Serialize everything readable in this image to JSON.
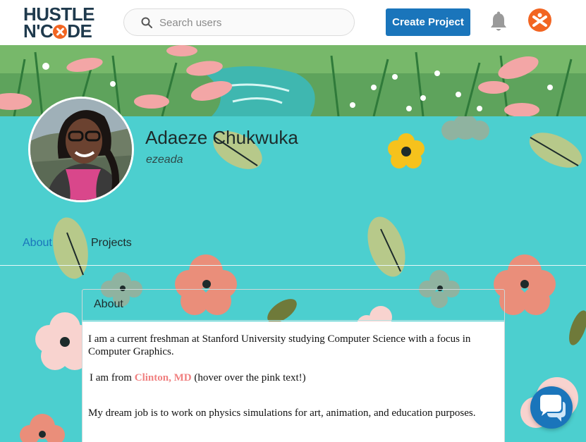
{
  "header": {
    "logo_line1": "HUSTLE",
    "logo_line2_prefix": "N'C",
    "logo_line2_suffix": "DE",
    "search_placeholder": "Search users",
    "create_label": "Create Project"
  },
  "profile": {
    "name": "Adaeze Chukwuka",
    "username": "ezeada"
  },
  "tabs": {
    "about": "About",
    "projects": "Projects"
  },
  "about_card": {
    "title": "About",
    "p1": "I am a current freshman at Stanford University studying Computer Science with a focus in Computer Graphics.",
    "p2_prefix": "I am from ",
    "p2_link": "Clinton, MD",
    "p2_suffix": " (hover over the pink text!)",
    "p3": "My dream job is to work on physics simulations for art, animation, and education purposes."
  },
  "colors": {
    "brand_blue": "#1a75bb",
    "brand_orange": "#f26522",
    "background_teal": "#4ccfcf",
    "pink_text": "#f08080"
  },
  "icons": {
    "search": "search-icon",
    "bell": "bell-icon",
    "avatar": "hustle-code-avatar-icon",
    "chat": "chat-bubble-icon"
  }
}
